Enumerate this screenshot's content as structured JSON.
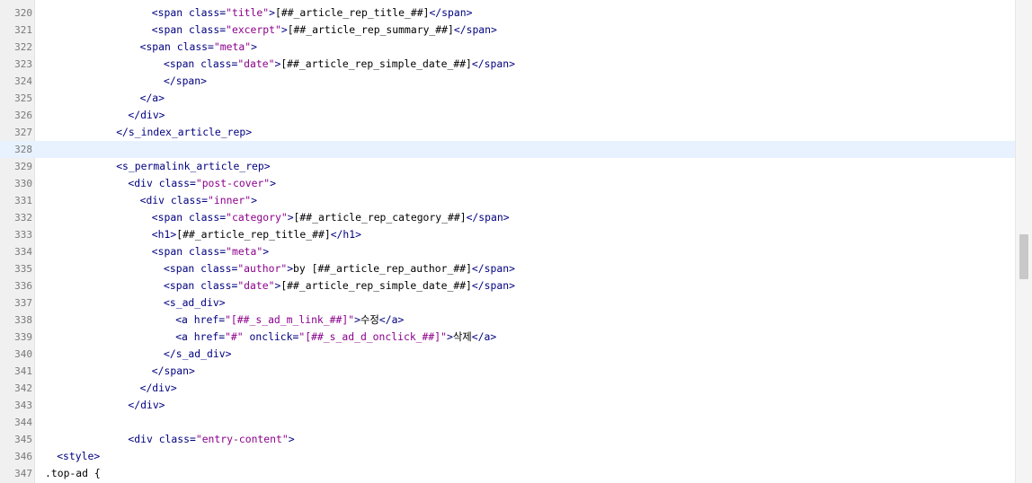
{
  "editor": {
    "active_line": "328",
    "lines": [
      {
        "n": "320",
        "indent": 9,
        "tokens": [
          {
            "c": "tag",
            "t": "<span "
          },
          {
            "c": "attr",
            "t": "class="
          },
          {
            "c": "str",
            "t": "\"title\""
          },
          {
            "c": "punc",
            "t": ">"
          },
          {
            "c": "text",
            "t": "[##_article_rep_title_##]"
          },
          {
            "c": "tag",
            "t": "</span>"
          }
        ]
      },
      {
        "n": "321",
        "indent": 9,
        "tokens": [
          {
            "c": "tag",
            "t": "<span "
          },
          {
            "c": "attr",
            "t": "class="
          },
          {
            "c": "str",
            "t": "\"excerpt\""
          },
          {
            "c": "punc",
            "t": ">"
          },
          {
            "c": "text",
            "t": "[##_article_rep_summary_##]"
          },
          {
            "c": "tag",
            "t": "</span>"
          }
        ]
      },
      {
        "n": "322",
        "indent": 8,
        "tokens": [
          {
            "c": "tag",
            "t": "<span "
          },
          {
            "c": "attr",
            "t": "class="
          },
          {
            "c": "str",
            "t": "\"meta\""
          },
          {
            "c": "punc",
            "t": ">"
          }
        ]
      },
      {
        "n": "323",
        "indent": 10,
        "tokens": [
          {
            "c": "tag",
            "t": "<span "
          },
          {
            "c": "attr",
            "t": "class="
          },
          {
            "c": "str",
            "t": "\"date\""
          },
          {
            "c": "punc",
            "t": ">"
          },
          {
            "c": "text",
            "t": "[##_article_rep_simple_date_##]"
          },
          {
            "c": "tag",
            "t": "</span>"
          }
        ]
      },
      {
        "n": "324",
        "indent": 10,
        "tokens": [
          {
            "c": "tag",
            "t": "</span>"
          }
        ]
      },
      {
        "n": "325",
        "indent": 8,
        "tokens": [
          {
            "c": "tag",
            "t": "</a>"
          }
        ]
      },
      {
        "n": "326",
        "indent": 7,
        "tokens": [
          {
            "c": "tag",
            "t": "</div>"
          }
        ]
      },
      {
        "n": "327",
        "indent": 6,
        "tokens": [
          {
            "c": "tag",
            "t": "</s_index_article_rep>"
          }
        ]
      },
      {
        "n": "328",
        "indent": 0,
        "tokens": []
      },
      {
        "n": "329",
        "indent": 6,
        "tokens": [
          {
            "c": "tag",
            "t": "<s_permalink_article_rep>"
          }
        ]
      },
      {
        "n": "330",
        "indent": 7,
        "tokens": [
          {
            "c": "tag",
            "t": "<div "
          },
          {
            "c": "attr",
            "t": "class="
          },
          {
            "c": "str",
            "t": "\"post-cover\""
          },
          {
            "c": "punc",
            "t": ">"
          }
        ]
      },
      {
        "n": "331",
        "indent": 8,
        "tokens": [
          {
            "c": "tag",
            "t": "<div "
          },
          {
            "c": "attr",
            "t": "class="
          },
          {
            "c": "str",
            "t": "\"inner\""
          },
          {
            "c": "punc",
            "t": ">"
          }
        ]
      },
      {
        "n": "332",
        "indent": 9,
        "tokens": [
          {
            "c": "tag",
            "t": "<span "
          },
          {
            "c": "attr",
            "t": "class="
          },
          {
            "c": "str",
            "t": "\"category\""
          },
          {
            "c": "punc",
            "t": ">"
          },
          {
            "c": "text",
            "t": "[##_article_rep_category_##]"
          },
          {
            "c": "tag",
            "t": "</span>"
          }
        ]
      },
      {
        "n": "333",
        "indent": 9,
        "tokens": [
          {
            "c": "tag",
            "t": "<h1>"
          },
          {
            "c": "text",
            "t": "[##_article_rep_title_##]"
          },
          {
            "c": "tag",
            "t": "</h1>"
          }
        ]
      },
      {
        "n": "334",
        "indent": 9,
        "tokens": [
          {
            "c": "tag",
            "t": "<span "
          },
          {
            "c": "attr",
            "t": "class="
          },
          {
            "c": "str",
            "t": "\"meta\""
          },
          {
            "c": "punc",
            "t": ">"
          }
        ]
      },
      {
        "n": "335",
        "indent": 10,
        "tokens": [
          {
            "c": "tag",
            "t": "<span "
          },
          {
            "c": "attr",
            "t": "class="
          },
          {
            "c": "str",
            "t": "\"author\""
          },
          {
            "c": "punc",
            "t": ">"
          },
          {
            "c": "text",
            "t": "by [##_article_rep_author_##]"
          },
          {
            "c": "tag",
            "t": "</span>"
          }
        ]
      },
      {
        "n": "336",
        "indent": 10,
        "tokens": [
          {
            "c": "tag",
            "t": "<span "
          },
          {
            "c": "attr",
            "t": "class="
          },
          {
            "c": "str",
            "t": "\"date\""
          },
          {
            "c": "punc",
            "t": ">"
          },
          {
            "c": "text",
            "t": "[##_article_rep_simple_date_##]"
          },
          {
            "c": "tag",
            "t": "</span>"
          }
        ]
      },
      {
        "n": "337",
        "indent": 10,
        "tokens": [
          {
            "c": "tag",
            "t": "<s_ad_div>"
          }
        ]
      },
      {
        "n": "338",
        "indent": 11,
        "tokens": [
          {
            "c": "tag",
            "t": "<a "
          },
          {
            "c": "attr",
            "t": "href="
          },
          {
            "c": "str",
            "t": "\"[##_s_ad_m_link_##]\""
          },
          {
            "c": "punc",
            "t": ">"
          },
          {
            "c": "text",
            "t": "수정"
          },
          {
            "c": "tag",
            "t": "</a>"
          }
        ]
      },
      {
        "n": "339",
        "indent": 11,
        "tokens": [
          {
            "c": "tag",
            "t": "<a "
          },
          {
            "c": "attr",
            "t": "href="
          },
          {
            "c": "str",
            "t": "\"#\""
          },
          {
            "c": "attr",
            "t": " onclick="
          },
          {
            "c": "str",
            "t": "\"[##_s_ad_d_onclick_##]\""
          },
          {
            "c": "punc",
            "t": ">"
          },
          {
            "c": "text",
            "t": "삭제"
          },
          {
            "c": "tag",
            "t": "</a>"
          }
        ]
      },
      {
        "n": "340",
        "indent": 10,
        "tokens": [
          {
            "c": "tag",
            "t": "</s_ad_div>"
          }
        ]
      },
      {
        "n": "341",
        "indent": 9,
        "tokens": [
          {
            "c": "tag",
            "t": "</span>"
          }
        ]
      },
      {
        "n": "342",
        "indent": 8,
        "tokens": [
          {
            "c": "tag",
            "t": "</div>"
          }
        ]
      },
      {
        "n": "343",
        "indent": 7,
        "tokens": [
          {
            "c": "tag",
            "t": "</div>"
          }
        ]
      },
      {
        "n": "344",
        "indent": 0,
        "tokens": []
      },
      {
        "n": "345",
        "indent": 7,
        "tokens": [
          {
            "c": "tag",
            "t": "<div "
          },
          {
            "c": "attr",
            "t": "class="
          },
          {
            "c": "str",
            "t": "\"entry-content\""
          },
          {
            "c": "punc",
            "t": ">"
          }
        ]
      },
      {
        "n": "346",
        "indent": 1,
        "tokens": [
          {
            "c": "tag",
            "t": "<style>"
          }
        ]
      },
      {
        "n": "347",
        "indent": 0,
        "tokens": [
          {
            "c": "plain",
            "t": ".top-ad {"
          }
        ]
      }
    ]
  },
  "colors": {
    "gutter_bg": "#f0f0f0",
    "active_line_bg": "#e8f2fe",
    "tag": "#000080",
    "string": "#8b008b",
    "text": "#000000"
  }
}
